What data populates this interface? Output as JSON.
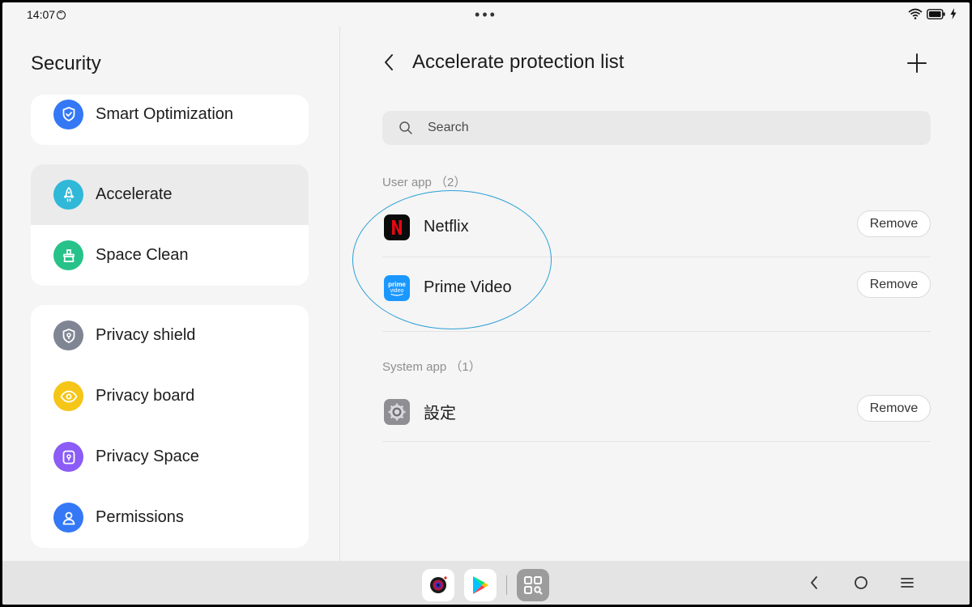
{
  "status_bar": {
    "time": "14:07",
    "dots": "•••"
  },
  "left_panel": {
    "title": "Security",
    "groups": [
      [
        {
          "label": "Smart Optimization",
          "icon": "shield-check-icon",
          "color": "#3478f6"
        }
      ],
      [
        {
          "label": "Accelerate",
          "icon": "rocket-icon",
          "color": "#2fb8d8",
          "selected": true
        },
        {
          "label": "Space Clean",
          "icon": "broom-icon",
          "color": "#27c28a"
        }
      ],
      [
        {
          "label": "Privacy shield",
          "icon": "privacy-shield-icon",
          "color": "#7f8593"
        },
        {
          "label": "Privacy board",
          "icon": "eye-icon",
          "color": "#f5c518"
        },
        {
          "label": "Privacy Space",
          "icon": "lock-icon",
          "color": "#8b5cf6"
        },
        {
          "label": "Permissions",
          "icon": "person-icon",
          "color": "#3478f6"
        }
      ]
    ]
  },
  "right_panel": {
    "title": "Accelerate protection list",
    "search_placeholder": "Search",
    "user_section": "User app （2）",
    "system_section": "System app （1）",
    "user_apps": [
      {
        "name": "Netflix",
        "icon": "netflix-icon",
        "remove": "Remove"
      },
      {
        "name": "Prime Video",
        "icon": "prime-video-icon",
        "remove": "Remove"
      }
    ],
    "system_apps": [
      {
        "name": "設定",
        "icon": "settings-gear-icon",
        "remove": "Remove"
      }
    ],
    "prime_logo_text": "prime video"
  },
  "colors": {
    "accent": "#3478f6",
    "highlight_ring": "#2a9fd6",
    "netflix_red": "#e50914",
    "prime_blue": "#1a98ff"
  }
}
